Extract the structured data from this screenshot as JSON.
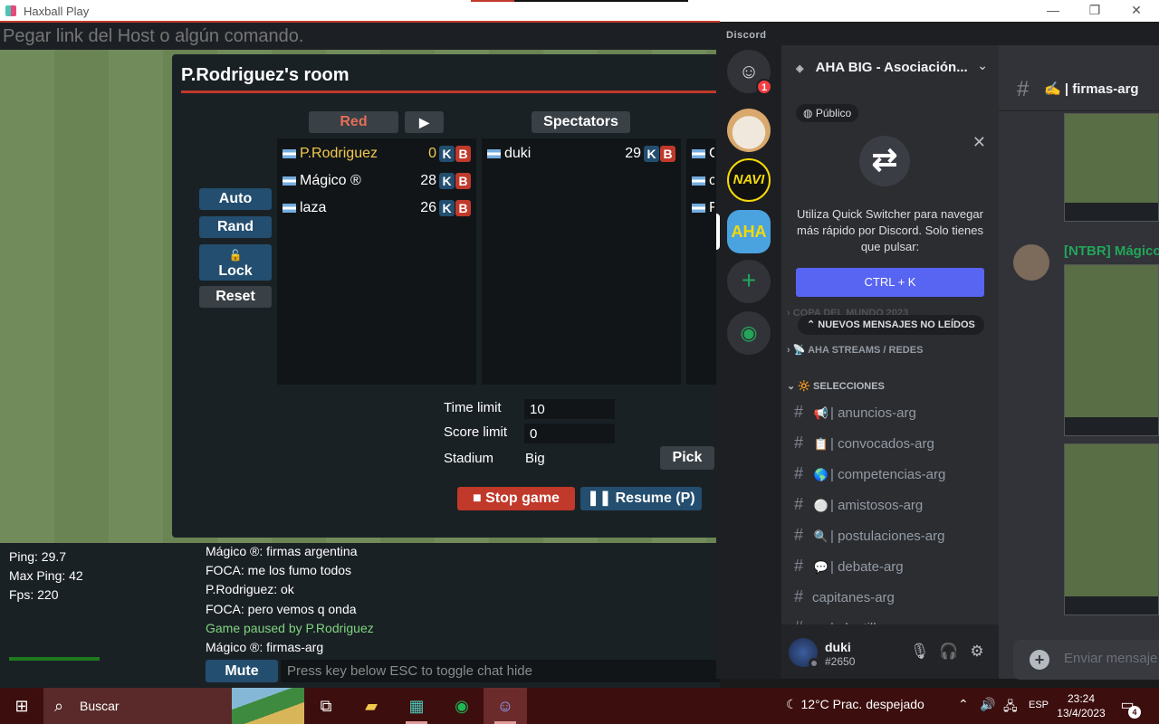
{
  "window": {
    "title": "Haxball Play",
    "minimize": "—",
    "restore": "❐",
    "close": "✕"
  },
  "command_bar": {
    "placeholder": "Pegar link del Host o algún comando."
  },
  "room": {
    "title": "P.Rodriguez's room",
    "buttons": {
      "auto": "Auto",
      "rand": "Rand",
      "lock_icon": "lock-icon",
      "lock": "Lock",
      "reset": "Reset"
    },
    "red_header": "Red",
    "play_glyph": "▶",
    "spectators_header": "Spectators",
    "red_players": [
      {
        "name": "P.Rodriguez",
        "ping": "0"
      },
      {
        "name": "Mágico ®",
        "ping": "28"
      },
      {
        "name": "laza",
        "ping": "26"
      }
    ],
    "spectators": [
      {
        "name": "duki",
        "ping": "29"
      }
    ],
    "blue_partial": [
      "G",
      "c",
      "F"
    ],
    "kick_label": "K",
    "ban_label": "B",
    "settings": {
      "time_limit_label": "Time limit",
      "time_limit": "10",
      "score_limit_label": "Score limit",
      "score_limit": "0",
      "stadium_label": "Stadium",
      "stadium": "Big",
      "pick": "Pick"
    },
    "stop_game": "Stop game",
    "resume": "Resume (P)"
  },
  "stats": {
    "ping": "Ping: 29.7",
    "max_ping": "Max Ping: 42",
    "fps": "Fps: 220"
  },
  "chat": {
    "lines": [
      {
        "text": "Mágico ®: firmas argentina",
        "system": false
      },
      {
        "text": "FOCA: me los fumo todos",
        "system": false
      },
      {
        "text": "P.Rodriguez: ok",
        "system": false
      },
      {
        "text": "FOCA: pero vemos q onda",
        "system": false
      },
      {
        "text": "Game paused by P.Rodriguez",
        "system": true
      },
      {
        "text": "Mágico ®: firmas-arg",
        "system": false
      }
    ],
    "mute": "Mute",
    "input_placeholder": "Press key below ESC to toggle chat hide"
  },
  "discord": {
    "brand": "Discord",
    "home_badge": "1",
    "guild_navi": "NAVI",
    "guild_aha": "AHA",
    "server_name": "AHA BIG - Asociación...",
    "public_label": "Público",
    "quick_switcher": {
      "text": "Utiliza Quick Switcher para navegar más rápido por Discord. Solo tienes que pulsar:",
      "shortcut": "CTRL + K"
    },
    "new_messages": "NUEVOS MENSAJES NO LEÍDOS",
    "categories": [
      {
        "label": "COPA DEL MUNDO 2023"
      },
      {
        "label": "AHA STREAMS / REDES"
      },
      {
        "label": "SELECCIONES"
      }
    ],
    "channels": [
      {
        "emoji": "📢",
        "name": "| anuncios-arg"
      },
      {
        "emoji": "📋",
        "name": "| convocados-arg"
      },
      {
        "emoji": "🌎",
        "name": "| competencias-arg"
      },
      {
        "emoji": "⚪",
        "name": "| amistosos-arg"
      },
      {
        "emoji": "🔍",
        "name": "| postulaciones-arg"
      },
      {
        "emoji": "💬",
        "name": "| debate-arg"
      },
      {
        "emoji": "",
        "name": "capitanes-arg"
      },
      {
        "emoji": "AR",
        "name": "| plantillas-arg"
      }
    ],
    "user": {
      "name": "duki",
      "tag": "#2650"
    },
    "channel_header": "✍️ | firmas-arg",
    "message_author": "[NTBR] Mágico",
    "message_placeholder": "Enviar mensaje"
  },
  "taskbar": {
    "search": "Buscar",
    "weather": "12°C  Prac. despejado",
    "lang": "ESP",
    "time": "23:24",
    "date": "13/4/2023",
    "notifications": "4"
  },
  "colors": {
    "red_team": "#e56e56",
    "kick": "#234e6f",
    "ban": "#c0392b",
    "discord_blurple": "#5865f2",
    "taskbar": "#3d0e0e"
  }
}
